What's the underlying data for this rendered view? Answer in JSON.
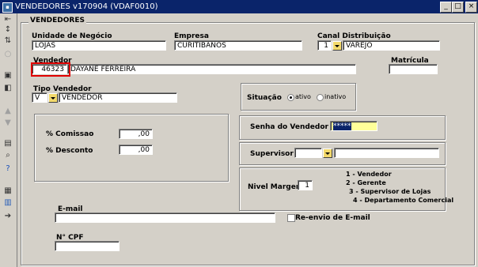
{
  "window": {
    "title": "VENDEDORES v170904 (VDAF0010)"
  },
  "group": {
    "title": "VENDEDORES"
  },
  "unidade": {
    "label": "Unidade de Negócio",
    "value": "LOJAS"
  },
  "empresa": {
    "label": "Empresa",
    "value": "CURITIBANOS"
  },
  "canal": {
    "label": "Canal Distribuição",
    "code": "1",
    "value": "VAREJO"
  },
  "vendedor": {
    "label": "Vendedor",
    "code": "46323",
    "name": "DAYANE FERREIRA"
  },
  "matricula": {
    "label": "Matrícula",
    "value": ""
  },
  "tipo_vendedor": {
    "label": "Tipo Vendedor",
    "code": "V",
    "value": "VENDEDOR"
  },
  "situacao": {
    "label": "Situação",
    "options": [
      "ativo",
      "inativo"
    ],
    "selected": "ativo"
  },
  "comissao": {
    "label": "% Comissao",
    "value": ",00"
  },
  "desconto": {
    "label": "% Desconto",
    "value": ",00"
  },
  "senha": {
    "label": "Senha do Vendedor",
    "value": "*****"
  },
  "supervisor": {
    "label": "Supervisor",
    "code": "",
    "name": ""
  },
  "nivel_margem": {
    "label": "Nivel Margem:",
    "value": "1",
    "legend": [
      "1 - Vendedor",
      "2 - Gerente",
      "3 - Supervisor de Lojas",
      "4 - Departamento Comercial"
    ]
  },
  "email": {
    "label": "E-mail",
    "value": "",
    "reenvio_label": "Re-envio de E-mail"
  },
  "cpf": {
    "label": "N° CPF",
    "value": ""
  },
  "colors": {
    "titlebar": "#0a246a",
    "highlight": "#ffff99",
    "redbox": "#e00000"
  }
}
